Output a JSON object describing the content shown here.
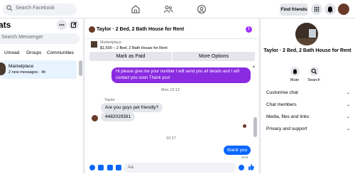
{
  "topbar": {
    "search_placeholder": "Search Facebook",
    "find_friends": "Find friends"
  },
  "sidebar": {
    "title": "ats",
    "search_placeholder": "Search Messenger",
    "tabs": [
      "Unread",
      "Groups",
      "Communities"
    ],
    "conversation": {
      "name": "Marketplace",
      "subtitle": "2 new messages · 4h"
    }
  },
  "chat": {
    "title": "Taylor · 2 Bed, 2 Bath House for Rent",
    "banner": {
      "label": "Marketplace",
      "item": "$1,500 – 2 Bed, 2 Bath House for Rent",
      "mark_paid": "Mark as Paid",
      "more_options": "More Options"
    },
    "messages": {
      "out1": "Hi please give me your number I will send you all details and I will contact you soon Thank you!",
      "time1": "Mon 12:12",
      "sender": "Taylor",
      "in1": "Are you guys pet friendly?",
      "in2": "4482029381",
      "time2": "10:17",
      "out2": "thank you",
      "status": "Sent"
    },
    "composer_placeholder": "Aa"
  },
  "details": {
    "title": "Taylor · 2 Bed, 2 Bath House for Rent",
    "actions": [
      "Mute",
      "Search"
    ],
    "menu": [
      "Customise chat",
      "Chat members",
      "Media, files and links",
      "Privacy and support"
    ]
  },
  "colors": {
    "accent": "#0866ff",
    "outgoing_bubble": "#8a2be2"
  }
}
